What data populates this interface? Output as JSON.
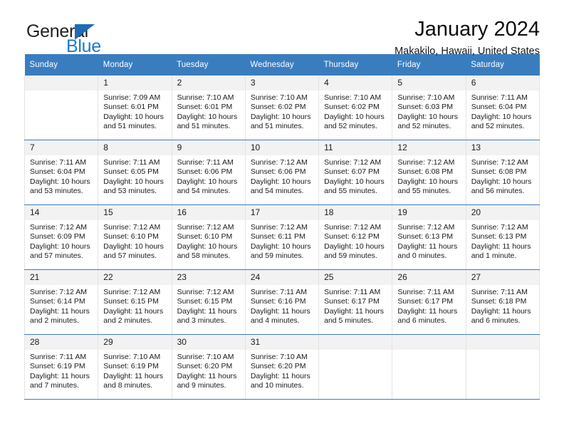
{
  "brand": {
    "name_dark": "General",
    "name_blue": "Blue",
    "accent_color": "#2079c8",
    "triangle_color": "#1f6cb4"
  },
  "header": {
    "title": "January 2024",
    "subtitle": "Makakilo, Hawaii, United States"
  },
  "calendar": {
    "header_bg": "#3a7dbf",
    "daynum_bg": "#f2f2f2",
    "weekdays": [
      "Sunday",
      "Monday",
      "Tuesday",
      "Wednesday",
      "Thursday",
      "Friday",
      "Saturday"
    ],
    "labels": {
      "sunrise": "Sunrise:",
      "sunset": "Sunset:",
      "daylight": "Daylight:"
    },
    "weeks": [
      [
        {
          "day": "",
          "sunrise": "",
          "sunset": "",
          "daylight_1": "",
          "daylight_2": ""
        },
        {
          "day": "1",
          "sunrise": "Sunrise: 7:09 AM",
          "sunset": "Sunset: 6:01 PM",
          "daylight_1": "Daylight: 10 hours",
          "daylight_2": "and 51 minutes."
        },
        {
          "day": "2",
          "sunrise": "Sunrise: 7:10 AM",
          "sunset": "Sunset: 6:01 PM",
          "daylight_1": "Daylight: 10 hours",
          "daylight_2": "and 51 minutes."
        },
        {
          "day": "3",
          "sunrise": "Sunrise: 7:10 AM",
          "sunset": "Sunset: 6:02 PM",
          "daylight_1": "Daylight: 10 hours",
          "daylight_2": "and 51 minutes."
        },
        {
          "day": "4",
          "sunrise": "Sunrise: 7:10 AM",
          "sunset": "Sunset: 6:02 PM",
          "daylight_1": "Daylight: 10 hours",
          "daylight_2": "and 52 minutes."
        },
        {
          "day": "5",
          "sunrise": "Sunrise: 7:10 AM",
          "sunset": "Sunset: 6:03 PM",
          "daylight_1": "Daylight: 10 hours",
          "daylight_2": "and 52 minutes."
        },
        {
          "day": "6",
          "sunrise": "Sunrise: 7:11 AM",
          "sunset": "Sunset: 6:04 PM",
          "daylight_1": "Daylight: 10 hours",
          "daylight_2": "and 52 minutes."
        }
      ],
      [
        {
          "day": "7",
          "sunrise": "Sunrise: 7:11 AM",
          "sunset": "Sunset: 6:04 PM",
          "daylight_1": "Daylight: 10 hours",
          "daylight_2": "and 53 minutes."
        },
        {
          "day": "8",
          "sunrise": "Sunrise: 7:11 AM",
          "sunset": "Sunset: 6:05 PM",
          "daylight_1": "Daylight: 10 hours",
          "daylight_2": "and 53 minutes."
        },
        {
          "day": "9",
          "sunrise": "Sunrise: 7:11 AM",
          "sunset": "Sunset: 6:06 PM",
          "daylight_1": "Daylight: 10 hours",
          "daylight_2": "and 54 minutes."
        },
        {
          "day": "10",
          "sunrise": "Sunrise: 7:12 AM",
          "sunset": "Sunset: 6:06 PM",
          "daylight_1": "Daylight: 10 hours",
          "daylight_2": "and 54 minutes."
        },
        {
          "day": "11",
          "sunrise": "Sunrise: 7:12 AM",
          "sunset": "Sunset: 6:07 PM",
          "daylight_1": "Daylight: 10 hours",
          "daylight_2": "and 55 minutes."
        },
        {
          "day": "12",
          "sunrise": "Sunrise: 7:12 AM",
          "sunset": "Sunset: 6:08 PM",
          "daylight_1": "Daylight: 10 hours",
          "daylight_2": "and 55 minutes."
        },
        {
          "day": "13",
          "sunrise": "Sunrise: 7:12 AM",
          "sunset": "Sunset: 6:08 PM",
          "daylight_1": "Daylight: 10 hours",
          "daylight_2": "and 56 minutes."
        }
      ],
      [
        {
          "day": "14",
          "sunrise": "Sunrise: 7:12 AM",
          "sunset": "Sunset: 6:09 PM",
          "daylight_1": "Daylight: 10 hours",
          "daylight_2": "and 57 minutes."
        },
        {
          "day": "15",
          "sunrise": "Sunrise: 7:12 AM",
          "sunset": "Sunset: 6:10 PM",
          "daylight_1": "Daylight: 10 hours",
          "daylight_2": "and 57 minutes."
        },
        {
          "day": "16",
          "sunrise": "Sunrise: 7:12 AM",
          "sunset": "Sunset: 6:10 PM",
          "daylight_1": "Daylight: 10 hours",
          "daylight_2": "and 58 minutes."
        },
        {
          "day": "17",
          "sunrise": "Sunrise: 7:12 AM",
          "sunset": "Sunset: 6:11 PM",
          "daylight_1": "Daylight: 10 hours",
          "daylight_2": "and 59 minutes."
        },
        {
          "day": "18",
          "sunrise": "Sunrise: 7:12 AM",
          "sunset": "Sunset: 6:12 PM",
          "daylight_1": "Daylight: 10 hours",
          "daylight_2": "and 59 minutes."
        },
        {
          "day": "19",
          "sunrise": "Sunrise: 7:12 AM",
          "sunset": "Sunset: 6:13 PM",
          "daylight_1": "Daylight: 11 hours",
          "daylight_2": "and 0 minutes."
        },
        {
          "day": "20",
          "sunrise": "Sunrise: 7:12 AM",
          "sunset": "Sunset: 6:13 PM",
          "daylight_1": "Daylight: 11 hours",
          "daylight_2": "and 1 minute."
        }
      ],
      [
        {
          "day": "21",
          "sunrise": "Sunrise: 7:12 AM",
          "sunset": "Sunset: 6:14 PM",
          "daylight_1": "Daylight: 11 hours",
          "daylight_2": "and 2 minutes."
        },
        {
          "day": "22",
          "sunrise": "Sunrise: 7:12 AM",
          "sunset": "Sunset: 6:15 PM",
          "daylight_1": "Daylight: 11 hours",
          "daylight_2": "and 2 minutes."
        },
        {
          "day": "23",
          "sunrise": "Sunrise: 7:12 AM",
          "sunset": "Sunset: 6:15 PM",
          "daylight_1": "Daylight: 11 hours",
          "daylight_2": "and 3 minutes."
        },
        {
          "day": "24",
          "sunrise": "Sunrise: 7:11 AM",
          "sunset": "Sunset: 6:16 PM",
          "daylight_1": "Daylight: 11 hours",
          "daylight_2": "and 4 minutes."
        },
        {
          "day": "25",
          "sunrise": "Sunrise: 7:11 AM",
          "sunset": "Sunset: 6:17 PM",
          "daylight_1": "Daylight: 11 hours",
          "daylight_2": "and 5 minutes."
        },
        {
          "day": "26",
          "sunrise": "Sunrise: 7:11 AM",
          "sunset": "Sunset: 6:17 PM",
          "daylight_1": "Daylight: 11 hours",
          "daylight_2": "and 6 minutes."
        },
        {
          "day": "27",
          "sunrise": "Sunrise: 7:11 AM",
          "sunset": "Sunset: 6:18 PM",
          "daylight_1": "Daylight: 11 hours",
          "daylight_2": "and 6 minutes."
        }
      ],
      [
        {
          "day": "28",
          "sunrise": "Sunrise: 7:11 AM",
          "sunset": "Sunset: 6:19 PM",
          "daylight_1": "Daylight: 11 hours",
          "daylight_2": "and 7 minutes."
        },
        {
          "day": "29",
          "sunrise": "Sunrise: 7:10 AM",
          "sunset": "Sunset: 6:19 PM",
          "daylight_1": "Daylight: 11 hours",
          "daylight_2": "and 8 minutes."
        },
        {
          "day": "30",
          "sunrise": "Sunrise: 7:10 AM",
          "sunset": "Sunset: 6:20 PM",
          "daylight_1": "Daylight: 11 hours",
          "daylight_2": "and 9 minutes."
        },
        {
          "day": "31",
          "sunrise": "Sunrise: 7:10 AM",
          "sunset": "Sunset: 6:20 PM",
          "daylight_1": "Daylight: 11 hours",
          "daylight_2": "and 10 minutes."
        },
        {
          "day": "",
          "sunrise": "",
          "sunset": "",
          "daylight_1": "",
          "daylight_2": ""
        },
        {
          "day": "",
          "sunrise": "",
          "sunset": "",
          "daylight_1": "",
          "daylight_2": ""
        },
        {
          "day": "",
          "sunrise": "",
          "sunset": "",
          "daylight_1": "",
          "daylight_2": ""
        }
      ]
    ]
  }
}
